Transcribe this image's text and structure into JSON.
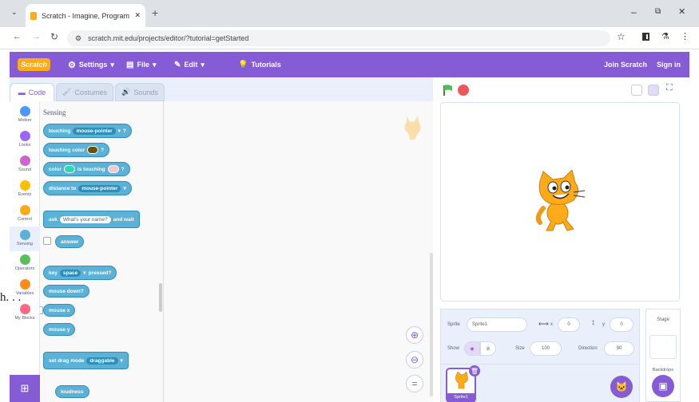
{
  "browser": {
    "tab_title": "Scratch - Imagine, Program, Sh",
    "url": "scratch.mit.edu/projects/editor/?tutorial=getStarted",
    "new_tab": "+"
  },
  "menu": {
    "logo": "Scratch",
    "settings": "Settings",
    "file": "File",
    "edit": "Edit",
    "tutorials": "Tutorials",
    "join": "Join Scratch",
    "signin": "Sign in"
  },
  "tabs": {
    "code": "Code",
    "costumes": "Costumes",
    "sounds": "Sounds"
  },
  "categories": [
    {
      "label": "Motion",
      "color": "#4c97ff"
    },
    {
      "label": "Looks",
      "color": "#9966ff"
    },
    {
      "label": "Sound",
      "color": "#cf63cf"
    },
    {
      "label": "Events",
      "color": "#ffbf00"
    },
    {
      "label": "Control",
      "color": "#ffab19"
    },
    {
      "label": "Sensing",
      "color": "#5cb1d6"
    },
    {
      "label": "Operators",
      "color": "#59c059"
    },
    {
      "label": "Variables",
      "color": "#ff8c1a"
    },
    {
      "label": "My Blocks",
      "color": "#ff6680"
    }
  ],
  "palette": {
    "heading": "Sensing",
    "b1_text": "touching",
    "b1_opt": "mouse-pointer",
    "b2_text": "touching color",
    "b3_a": "color",
    "b3_b": "is touching",
    "b4_text": "distance to",
    "b4_opt": "mouse-pointer",
    "b5_a": "ask",
    "b5_input": "What's your name?",
    "b5_b": "and wait",
    "b6_text": "answer",
    "b7_a": "key",
    "b7_opt": "space",
    "b7_b": "pressed?",
    "b8_text": "mouse down?",
    "b9_text": "mouse x",
    "b10_text": "mouse y",
    "b11_a": "set drag mode",
    "b11_opt": "draggable",
    "b12_text": "loudness"
  },
  "stray_text": "h. . .",
  "sprite_info": {
    "sprite_label": "Sprite",
    "sprite_name": "Sprite1",
    "x_val": "0",
    "y_val": "0",
    "show_label": "Show",
    "size_label": "Size",
    "size_val": "100",
    "direction_label": "Direction",
    "direction_val": "90",
    "thumb_label": "Sprite1"
  },
  "stage_panel": {
    "title": "Stage",
    "backdrops": "Backdrops"
  }
}
